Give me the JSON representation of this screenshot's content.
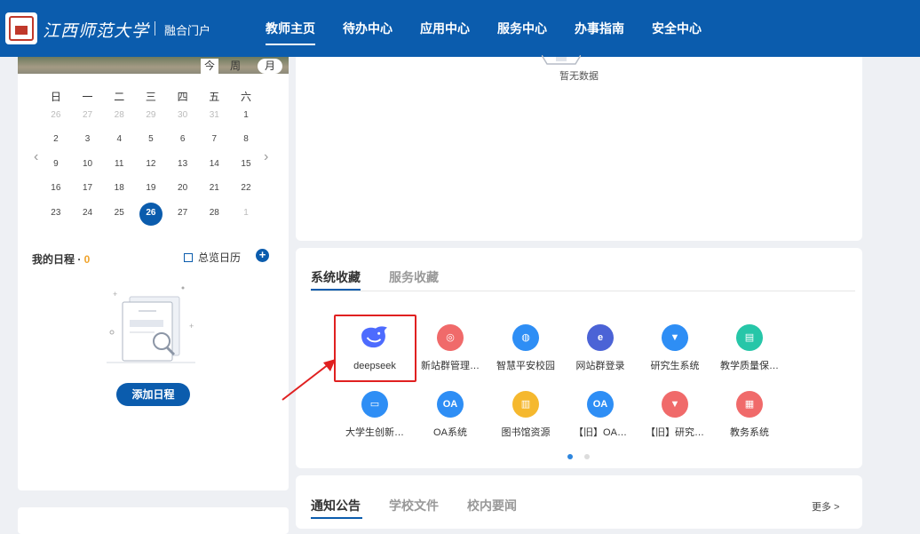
{
  "header": {
    "school_name": "江西师范大学",
    "portal_label": "融合门户",
    "nav": [
      "教师主页",
      "待办中心",
      "应用中心",
      "服务中心",
      "办事指南",
      "安全中心"
    ]
  },
  "calendar": {
    "view_tabs": [
      "今",
      "周",
      "月"
    ],
    "weekdays": [
      "日",
      "一",
      "二",
      "三",
      "四",
      "五",
      "六"
    ],
    "weeks": [
      [
        "26",
        "27",
        "28",
        "29",
        "30",
        "31",
        "1"
      ],
      [
        "2",
        "3",
        "4",
        "5",
        "6",
        "7",
        "8"
      ],
      [
        "9",
        "10",
        "11",
        "12",
        "13",
        "14",
        "15"
      ],
      [
        "16",
        "17",
        "18",
        "19",
        "20",
        "21",
        "22"
      ],
      [
        "23",
        "24",
        "25",
        "26",
        "27",
        "28",
        "1"
      ]
    ],
    "today": "26",
    "prev_icon": "chevron-left-icon",
    "next_icon": "chevron-right-icon"
  },
  "schedule": {
    "title": "我的日程 · ",
    "count": "0",
    "overview_label": "总览日历",
    "add_button": "添加日程"
  },
  "top_card": {
    "empty_text": "暂无数据"
  },
  "favorites": {
    "tabs": [
      "系统收藏",
      "服务收藏"
    ],
    "apps": [
      {
        "label": "deepseek",
        "icon": "whale-icon",
        "color": "#4d6bfe"
      },
      {
        "label": "新站群管理…",
        "icon": "globe-icon",
        "color": "#f06a6a"
      },
      {
        "label": "智慧平安校园",
        "icon": "planet-icon",
        "color": "#2e8ef5"
      },
      {
        "label": "网站群登录",
        "icon": "shield-icon",
        "color": "#4b63d6"
      },
      {
        "label": "研究生系统",
        "icon": "graduate-icon",
        "color": "#2e8ef5"
      },
      {
        "label": "教学质量保…",
        "icon": "report-icon",
        "color": "#26c6a8"
      },
      {
        "label": "大学生创新…",
        "icon": "monitor-icon",
        "color": "#2e8ef5"
      },
      {
        "label": "OA系统",
        "icon": "oa-icon",
        "color": "#2e8ef5"
      },
      {
        "label": "图书馆资源",
        "icon": "book-icon",
        "color": "#f5b82e"
      },
      {
        "label": "【旧】OA…",
        "icon": "oa-icon",
        "color": "#2e8ef5"
      },
      {
        "label": "【旧】研究…",
        "icon": "graduate-icon",
        "color": "#f06a6a"
      },
      {
        "label": "教务系统",
        "icon": "open-book-icon",
        "color": "#f06a6a"
      }
    ]
  },
  "news": {
    "tabs": [
      "通知公告",
      "学校文件",
      "校内要闻"
    ],
    "more": "更多 >"
  }
}
